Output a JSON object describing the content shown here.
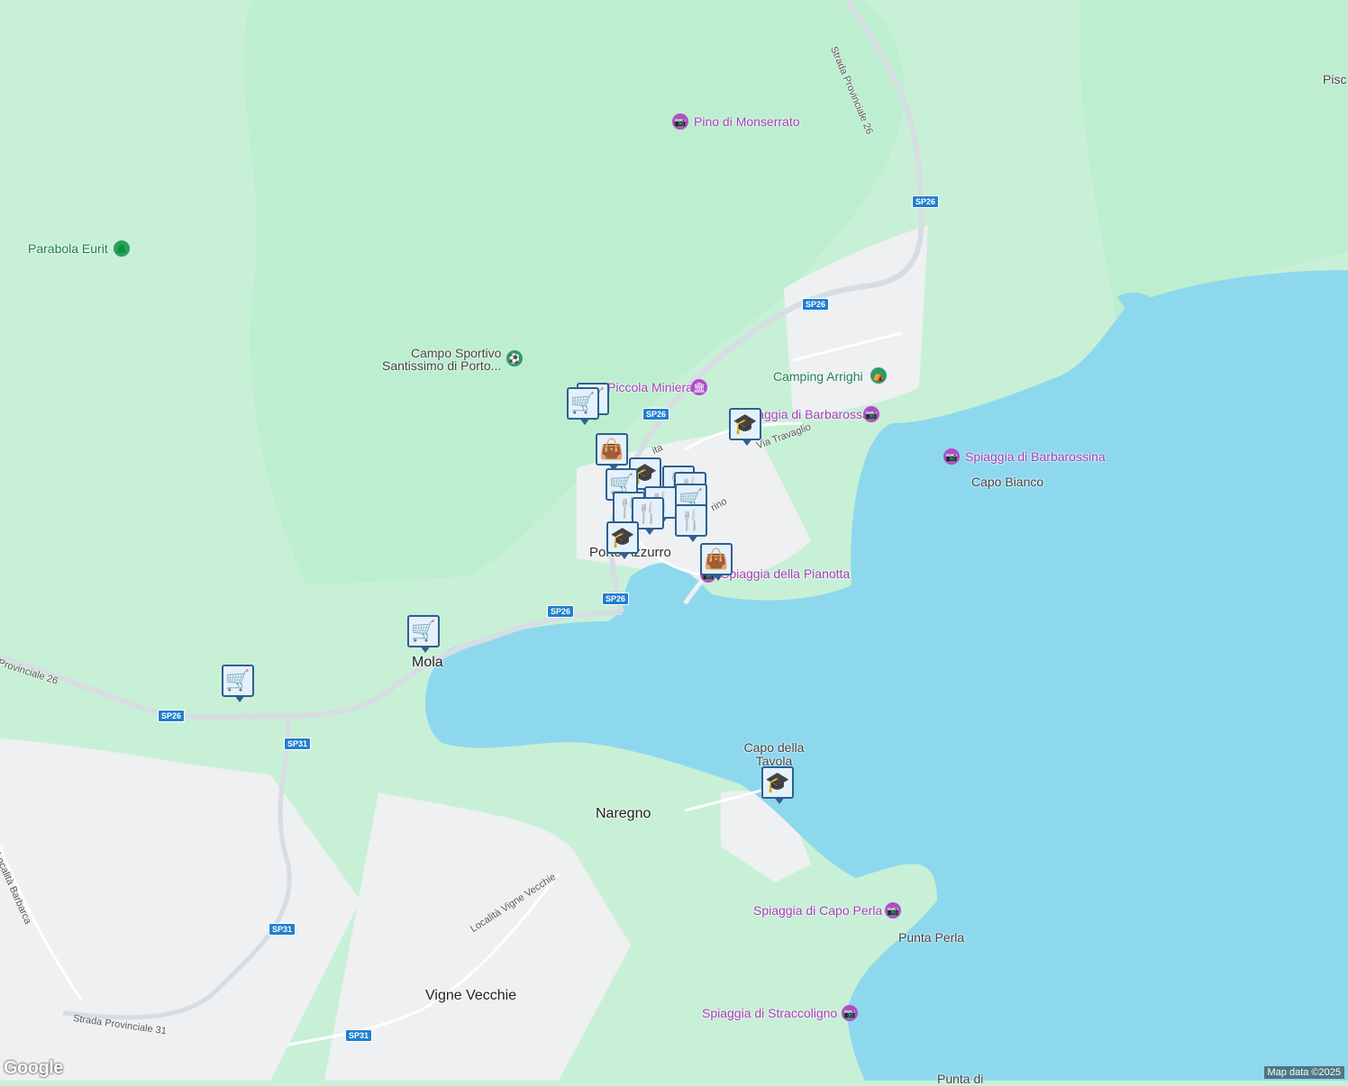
{
  "colors": {
    "water": "#8ed8ee",
    "land": "#c8f0d6",
    "forest": "#bdeed0",
    "urban": "#eef0f2",
    "road": "#ffffff",
    "main_road": "#d6dde3",
    "marker": "#2f5f8f",
    "poi_purple": "#b44bcb"
  },
  "places": {
    "porto_azzurro": "Porto Azzurro",
    "mola": "Mola",
    "naregno": "Naregno",
    "vigne_vecchie": "Vigne Vecchie",
    "capo_bianco": "Capo Bianco",
    "capo_della_tavola": "Capo della Tavola",
    "punta_perla": "Punta Perla",
    "pisc": "Pisc",
    "punta_di": "Punta di"
  },
  "pois": {
    "pino_di_monserrato": "Pino di Monserrato",
    "parabola_eurit": "Parabola Eurit",
    "campo_sportivo": "Campo Sportivo",
    "campo_sportivo_2": "Santissimo di Porto...",
    "piccola_miniera": "Piccola Miniera",
    "camping_arrighi": "Camping Arrighi",
    "spiaggia_barbarossa": "Spiaggia di Barbarossa",
    "spiaggia_barbarossina": "Spiaggia di Barbarossina",
    "spiaggia_pianotta": "Spiaggia della Pianotta",
    "spiaggia_capo_perla": "Spiaggia di Capo Perla",
    "spiaggia_straccoligno": "Spiaggia di Straccoligno"
  },
  "streets": {
    "sp26_vertical": "Strada Provinciale 26",
    "sp26_west": "Provinciale 26",
    "sp31": "Strada Provinciale 31",
    "via_travaglio": "Via Travaglio",
    "vigne_vecchie_road": "Località Vigne Vecchie",
    "barbarca": "Località Barbarca",
    "ita": "ita",
    "rino": "rino"
  },
  "shields": {
    "sp26": "SP26",
    "sp31": "SP31"
  },
  "icons": {
    "cart": "🛒",
    "bag": "👜",
    "school": "🎓",
    "fork": "🍴",
    "camera": "📷",
    "tree": "🌲",
    "camp": "⛺",
    "museum": "🏛",
    "sport": "⚽"
  },
  "footer": {
    "attribution": "Map data ©2025",
    "logo": "Google"
  }
}
